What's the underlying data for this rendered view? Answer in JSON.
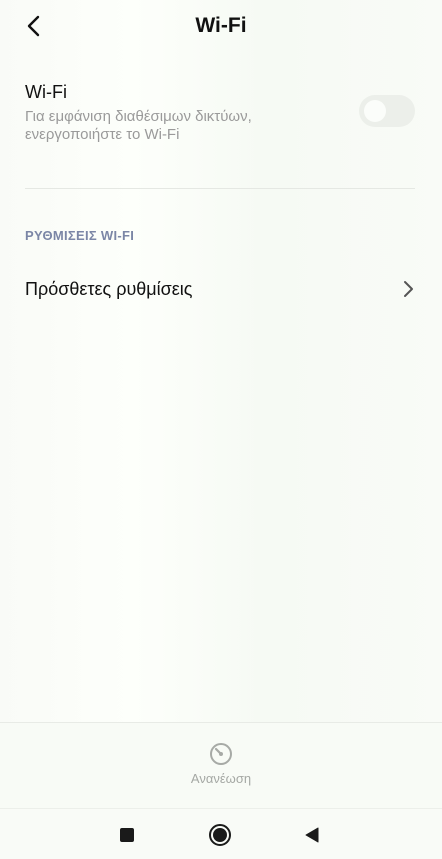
{
  "header": {
    "title": "Wi-Fi",
    "back_icon": "chevron-left-icon"
  },
  "wifi": {
    "label": "Wi-Fi",
    "subtitle": "Για εμφάνιση διαθέσιμων δικτύων, ενεργοποιήστε το Wi-Fi",
    "enabled": false
  },
  "section": {
    "header": "ΡΥΘΜΙΣΕΙΣ WI-FI",
    "items": [
      {
        "label": "Πρόσθετες ρυθμίσεις",
        "icon": "chevron-right-icon"
      }
    ]
  },
  "action_bar": {
    "refresh_label": "Ανανέωση",
    "refresh_icon": "refresh-icon"
  },
  "nav_bar": {
    "recents_icon": "square-icon",
    "home_icon": "circle-icon",
    "back_icon": "triangle-back-icon"
  },
  "colors": {
    "section_header": "#7b86a6",
    "subtitle": "#9a9a9a",
    "toggle_off": "#ecefea",
    "background": "#fafcf8"
  }
}
